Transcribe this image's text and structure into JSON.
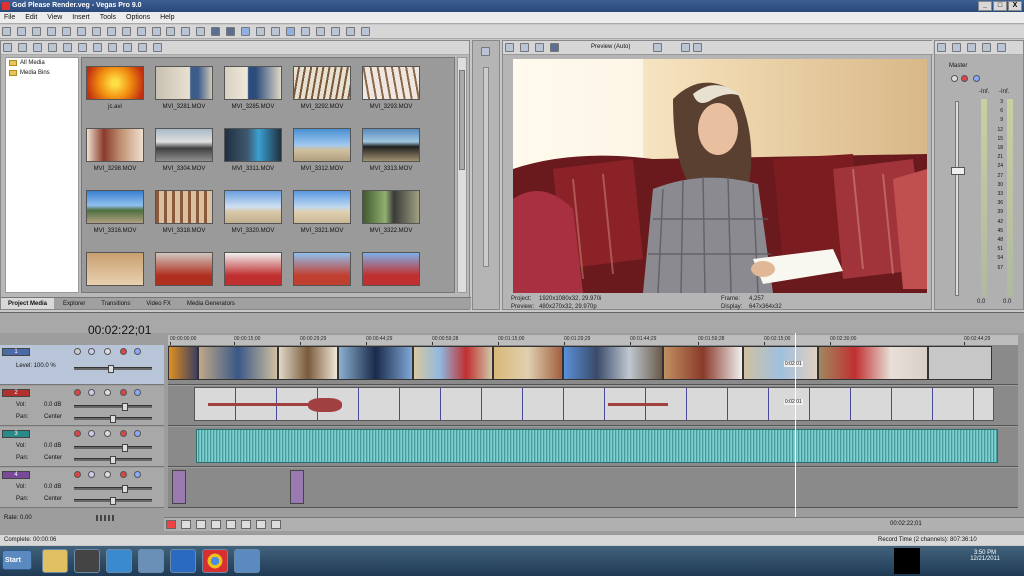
{
  "window": {
    "title": "God Please Render.veg - Vegas Pro 9.0",
    "min": "_",
    "max": "□",
    "close": "X"
  },
  "menu": [
    "File",
    "Edit",
    "View",
    "Insert",
    "Tools",
    "Options",
    "Help"
  ],
  "explorer": {
    "tree": [
      "All Media",
      "Media Bins"
    ],
    "items": [
      "jc.avi",
      "MVI_3281.MOV",
      "MVI_3285.MOV",
      "MVI_3292.MOV",
      "MVI_3293.MOV",
      "MVI_3298.MOV",
      "MVI_3304.MOV",
      "MVI_3311.MOV",
      "MVI_3312.MOV",
      "MVI_3313.MOV",
      "MVI_3316.MOV",
      "MVI_3318.MOV",
      "MVI_3320.MOV",
      "MVI_3321.MOV",
      "MVI_3322.MOV"
    ],
    "tabs": [
      "Project Media",
      "Explorer",
      "Transitions",
      "Video FX",
      "Media Generators"
    ]
  },
  "preview": {
    "mode": "Preview (Auto)",
    "project_label": "Project:",
    "project": "1920x1080x32, 29.970i",
    "preview_label": "Preview:",
    "preview": "480x270x32, 29.970p",
    "frame_label": "Frame:",
    "frame": "4,257",
    "display_label": "Display:",
    "display": "647x364x32"
  },
  "mixer": {
    "master": "Master",
    "scale_top": "-Inf.",
    "scale": [
      "3",
      "6",
      "9",
      "12",
      "15",
      "18",
      "21",
      "24",
      "27",
      "30",
      "33",
      "36",
      "39",
      "42",
      "45",
      "48",
      "51",
      "54",
      "57"
    ],
    "bottom": "0.0"
  },
  "timeline": {
    "timecode": "00:02:22;01",
    "ruler": [
      "00:00:00;00",
      "00:00:15;00",
      "00:00:29;29",
      "00:00:44;29",
      "00:00:59;28",
      "00:01:15;00",
      "00:01:29;29",
      "00:01:44;29",
      "00:01:59;28",
      "00:02:15;00",
      "00:02:30;00",
      "00:02:44;29"
    ],
    "tracks": [
      {
        "num": "1",
        "level": "Level: 100.0 %",
        "color": "#4a6aa8"
      },
      {
        "num": "2",
        "vol_label": "Vol:",
        "vol": "0.0 dB",
        "pan_label": "Pan:",
        "pan": "Center",
        "color": "#b03030"
      },
      {
        "num": "3",
        "vol_label": "Vol:",
        "vol": "0.0 dB",
        "pan_label": "Pan:",
        "pan": "Center",
        "color": "#2a8a8a"
      },
      {
        "num": "4",
        "vol_label": "Vol:",
        "vol": "0.0 dB",
        "pan_label": "Pan:",
        "pan": "Center",
        "color": "#7a4a9a"
      }
    ],
    "rate": "Rate: 0.00",
    "clip_tc1": "0:02:01",
    "clip_tc2": "0:02:01",
    "end_tc": "00:02:22;01"
  },
  "status": {
    "left": "Complete: 00:00:06",
    "right": "Record Time (2 channels): 807:36:10"
  },
  "taskbar": {
    "start": "Start",
    "time": "3:50 PM",
    "date": "12/21/2011"
  }
}
